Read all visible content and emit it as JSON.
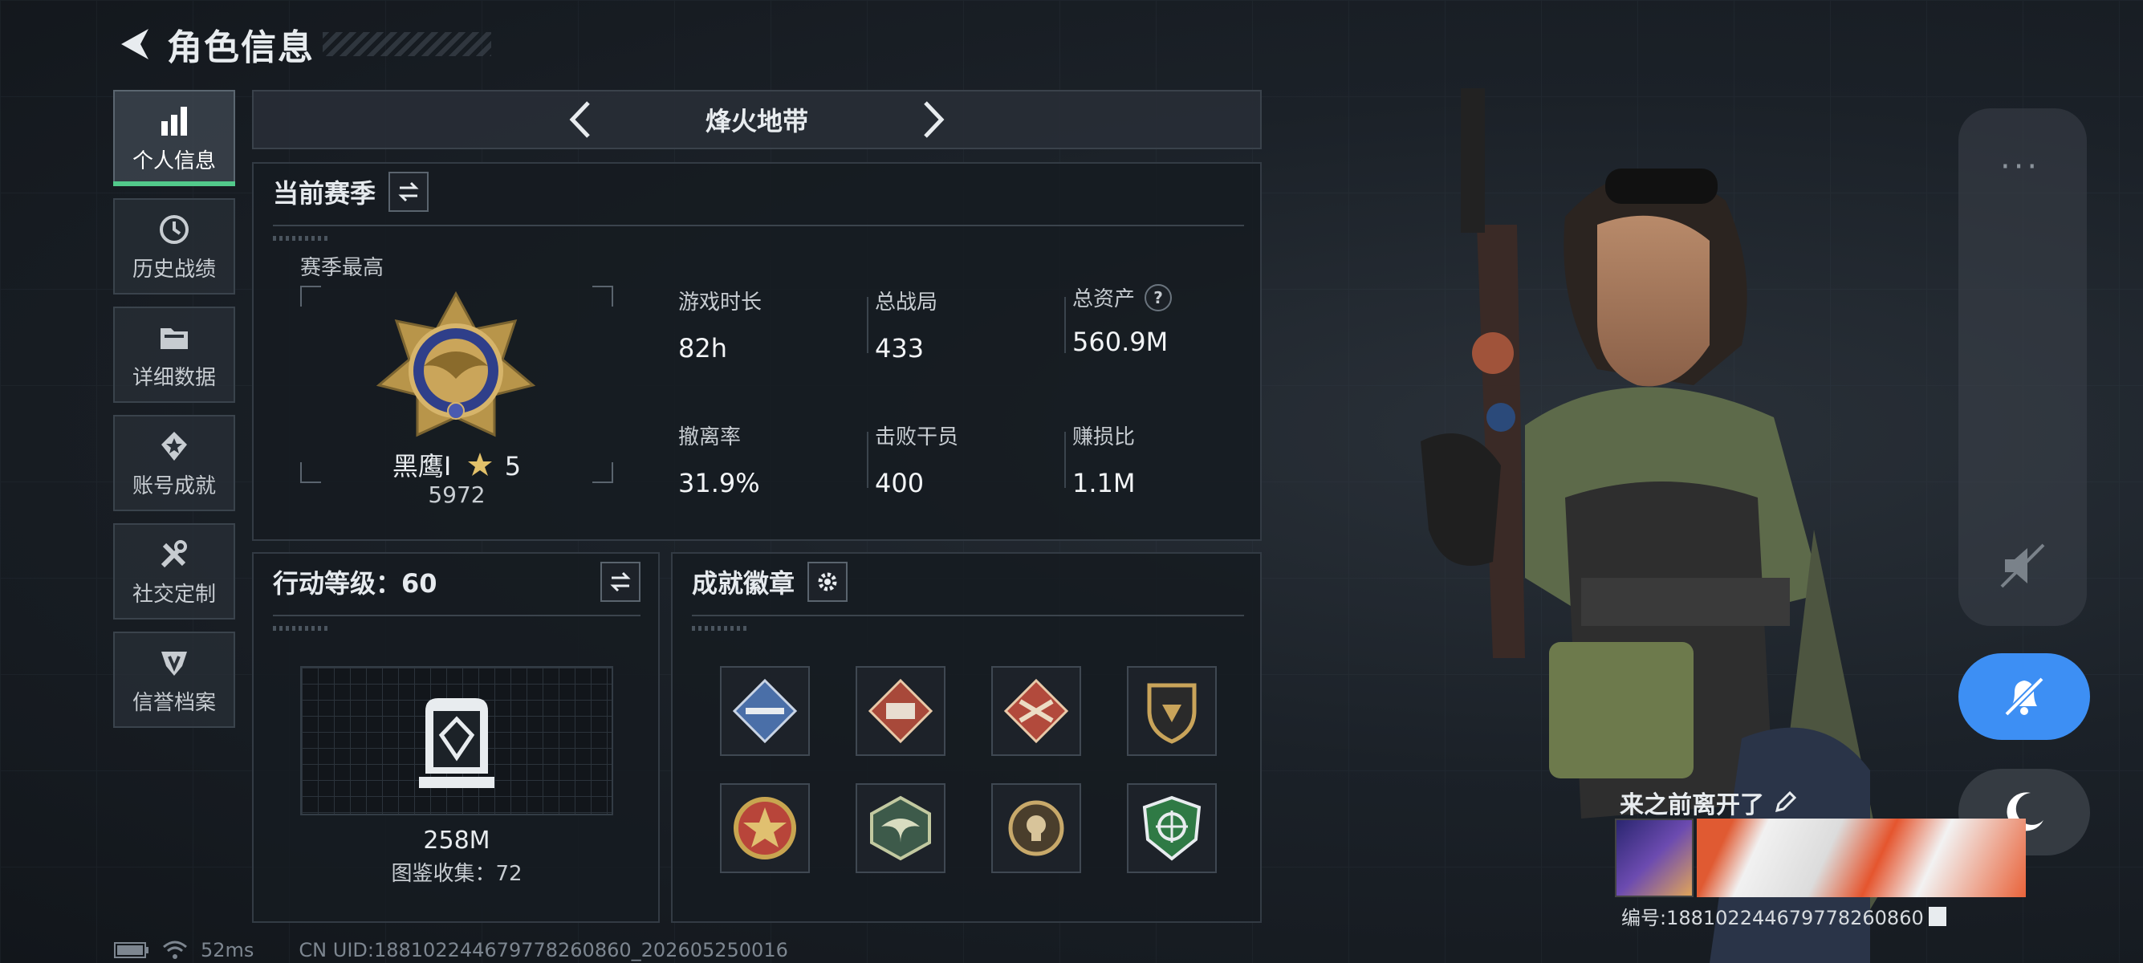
{
  "header": {
    "title": "角色信息"
  },
  "sidebar": {
    "items": [
      {
        "label": "个人信息",
        "icon": "bar-chart-icon",
        "active": true
      },
      {
        "label": "历史战绩",
        "icon": "history-icon",
        "active": false
      },
      {
        "label": "详细数据",
        "icon": "folder-icon",
        "active": false
      },
      {
        "label": "账号成就",
        "icon": "achievement-icon",
        "active": false
      },
      {
        "label": "社交定制",
        "icon": "tools-icon",
        "active": false
      },
      {
        "label": "信誉档案",
        "icon": "shield-icon",
        "active": false
      }
    ]
  },
  "mode": {
    "title": "烽火地带"
  },
  "season": {
    "title": "当前赛季",
    "subtitle": "赛季最高",
    "rank_name": "黑鹰I",
    "rank_stars": "5",
    "rank_score": "5972",
    "stats": [
      {
        "label": "游戏时长",
        "value": "82h"
      },
      {
        "label": "总战局",
        "value": "433"
      },
      {
        "label": "总资产",
        "value": "560.9M",
        "help": "?"
      },
      {
        "label": "撤离率",
        "value": "31.9%"
      },
      {
        "label": "击败干员",
        "value": "400"
      },
      {
        "label": "赚损比",
        "value": "1.1M"
      }
    ]
  },
  "level": {
    "title": "行动等级：60",
    "value": "258M",
    "collection": "图鉴收集：72"
  },
  "badges": {
    "title": "成就徽章",
    "items": [
      {
        "icon": "rifle-badge-icon",
        "color": "#4a6fa8"
      },
      {
        "icon": "truck-badge-icon",
        "color": "#a8493a"
      },
      {
        "icon": "crossed-guns-badge-icon",
        "color": "#b24a3c"
      },
      {
        "icon": "shield-badge-icon",
        "color": "#c9a45a"
      },
      {
        "icon": "star-badge-icon",
        "color": "#c8a550"
      },
      {
        "icon": "eagle-badge-icon",
        "color": "#5d8a6a"
      },
      {
        "icon": "skull-badge-icon",
        "color": "#8a7550"
      },
      {
        "icon": "target-badge-icon",
        "color": "#3f8b55"
      }
    ]
  },
  "status": {
    "ping": "52ms",
    "uid": "CN UID:18810224467977826086​0_202605250016"
  },
  "profile": {
    "nickname": "来之前离开了",
    "serial": "编号:188102244679778260860"
  },
  "colors": {
    "accent": "#52c98b",
    "primary_button": "#3d8ff4"
  }
}
